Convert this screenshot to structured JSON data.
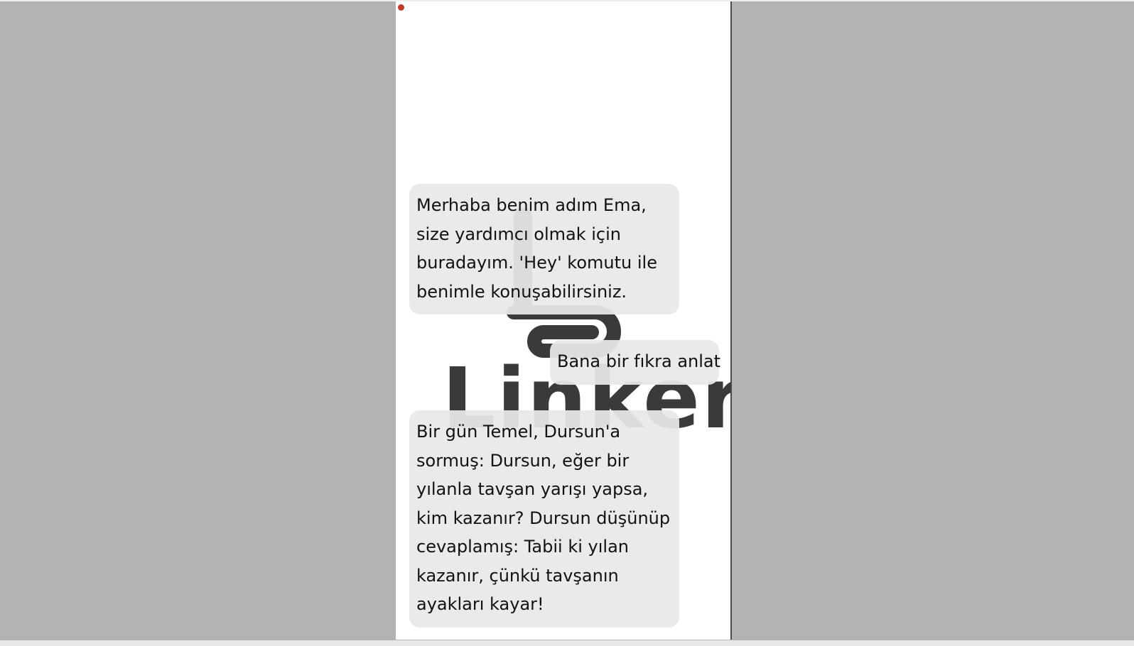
{
  "branding": {
    "logo_text": "Linker",
    "logo_color": "#3a3a3a"
  },
  "colors": {
    "backdrop": "#b3b3b3",
    "screen": "#ffffff",
    "bubble": "#e8e8e8",
    "recording_dot": "#c0392b"
  },
  "chat": {
    "messages": [
      {
        "sender": "bot",
        "text": "Merhaba benim adım Ema, size yardımcı olmak için buradayım. 'Hey' komutu ile benimle konuşabilirsiniz."
      },
      {
        "sender": "user",
        "text": "Bana bir fıkra anlat"
      },
      {
        "sender": "bot",
        "text": "Bir gün Temel, Dursun'a sormuş: Dursun, eğer bir yılanla tavşan yarışı yapsa, kim kazanır? Dursun düşünüp cevaplamış: Tabii ki yılan kazanır, çünkü tavşanın ayakları kayar!"
      }
    ]
  }
}
